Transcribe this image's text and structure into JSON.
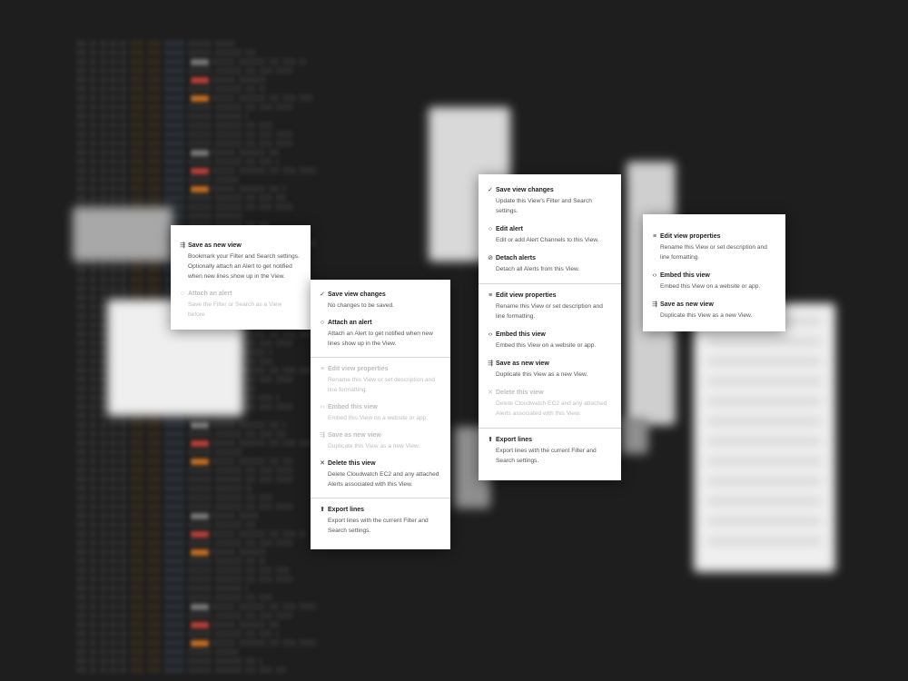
{
  "menus": {
    "save_as_new": [
      {
        "icon": "save-as-icon",
        "glyph": "⇶",
        "title": "Save as new view",
        "desc": "Bookmark your Filter and Search settings. Optionally attach an Alert to get notified when new lines show up in the View.",
        "enabled": true
      },
      {
        "icon": "bell-icon",
        "glyph": "○",
        "title": "Attach an alert",
        "desc": "Save the Filter or Search as a View before",
        "enabled": false
      }
    ],
    "unsaved_changes": [
      {
        "icon": "check-icon",
        "glyph": "✓",
        "title": "Save view changes",
        "desc": "No changes to be saved.",
        "enabled": true
      },
      {
        "icon": "bell-icon",
        "glyph": "○",
        "title": "Attach an alert",
        "desc": "Attach an Alert to get notified when new lines show up in the View.",
        "enabled": true
      },
      {
        "separator": true
      },
      {
        "icon": "list-icon",
        "glyph": "≡",
        "title": "Edit view properties",
        "desc": "Rename this View or set description and line formatting.",
        "enabled": false
      },
      {
        "icon": "code-icon",
        "glyph": "‹›",
        "title": "Embed this view",
        "desc": "Embed this View on a website or app.",
        "enabled": false
      },
      {
        "icon": "save-as-icon",
        "glyph": "⇶",
        "title": "Save as new view",
        "desc": "Duplicate this View as a new View.",
        "enabled": false
      },
      {
        "icon": "close-icon",
        "glyph": "✕",
        "title": "Delete this view",
        "desc": "Delete Cloudwatch EC2 and any attached Alerts associated with this View.",
        "enabled": true
      },
      {
        "separator": true
      },
      {
        "icon": "export-icon",
        "glyph": "⬆",
        "title": "Export lines",
        "desc": "Export lines with the current Filter and Search settings.",
        "enabled": true
      }
    ],
    "saved_view": [
      {
        "icon": "check-icon",
        "glyph": "✓",
        "title": "Save view changes",
        "desc": "Update this View's Filter and Search settings.",
        "enabled": true
      },
      {
        "icon": "bell-icon",
        "glyph": "○",
        "title": "Edit alert",
        "desc": "Edit or add Alert Channels to this View.",
        "enabled": true
      },
      {
        "icon": "bell-off-icon",
        "glyph": "⊘",
        "title": "Detach alerts",
        "desc": "Detach all Alerts from this View.",
        "enabled": true
      },
      {
        "separator": true
      },
      {
        "icon": "list-icon",
        "glyph": "≡",
        "title": "Edit view properties",
        "desc": "Rename this View or set description and line formatting.",
        "enabled": true
      },
      {
        "icon": "code-icon",
        "glyph": "‹›",
        "title": "Embed this view",
        "desc": "Embed this View on a website or app.",
        "enabled": true
      },
      {
        "icon": "save-as-icon",
        "glyph": "⇶",
        "title": "Save as new view",
        "desc": "Duplicate this View as a new View.",
        "enabled": true
      },
      {
        "icon": "close-icon",
        "glyph": "✕",
        "title": "Delete this view",
        "desc": "Delete Cloudwatch EC2 and any attached Alerts associated with this View.",
        "enabled": false
      },
      {
        "separator": true
      },
      {
        "icon": "export-icon",
        "glyph": "⬆",
        "title": "Export lines",
        "desc": "Export lines with the current Filter and Search settings.",
        "enabled": true
      }
    ],
    "view_properties": [
      {
        "icon": "list-icon",
        "glyph": "≡",
        "title": "Edit view properties",
        "desc": "Rename this View or set description and line formatting.",
        "enabled": true
      },
      {
        "icon": "code-icon",
        "glyph": "‹›",
        "title": "Embed this view",
        "desc": "Embed this View on a website or app.",
        "enabled": true
      },
      {
        "icon": "save-as-icon",
        "glyph": "⇶",
        "title": "Save as new view",
        "desc": "Duplicate this View as a new View.",
        "enabled": true
      }
    ]
  }
}
